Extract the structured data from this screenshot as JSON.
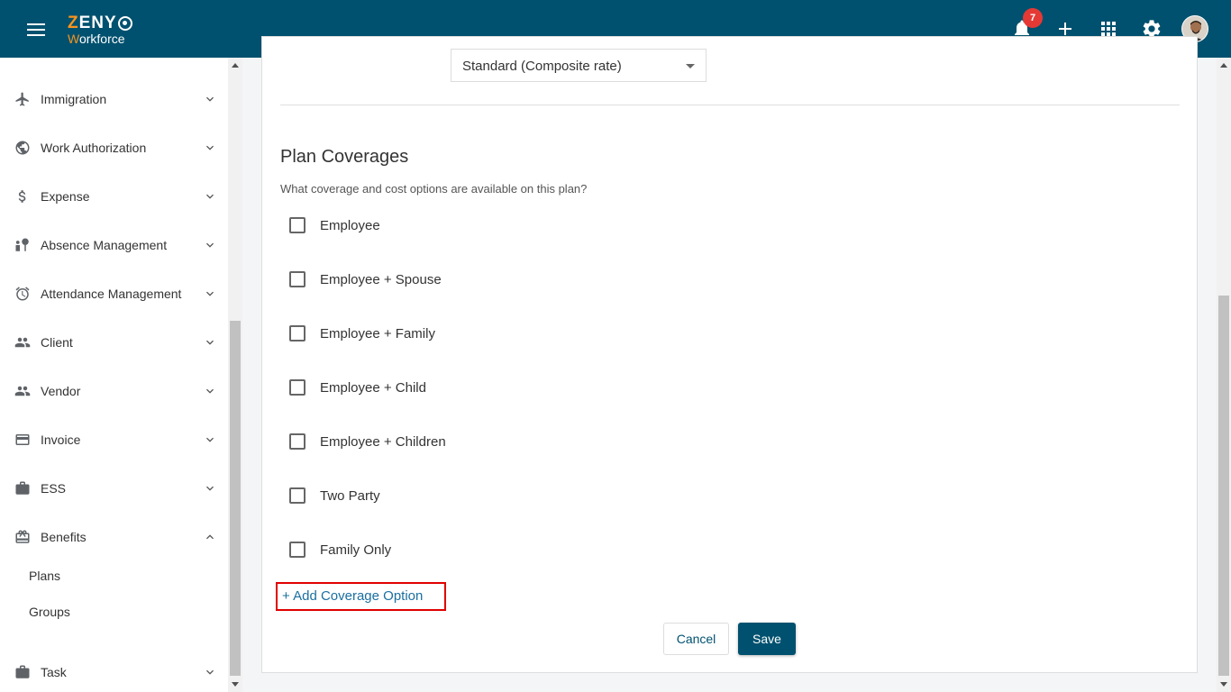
{
  "header": {
    "logo_main": "ZENY",
    "logo_sub": "Workforce",
    "notification_count": "7",
    "icons": [
      "menu-icon",
      "bell-icon",
      "plus-icon",
      "apps-grid-icon",
      "gear-icon",
      "avatar"
    ]
  },
  "sidebar": {
    "items": [
      {
        "label": "Immigration",
        "icon": "airplane-icon",
        "expanded": false
      },
      {
        "label": "Work Authorization",
        "icon": "globe-icon",
        "expanded": false
      },
      {
        "label": "Expense",
        "icon": "dollar-icon",
        "expanded": false
      },
      {
        "label": "Absence Management",
        "icon": "absence-icon",
        "expanded": false
      },
      {
        "label": "Attendance Management",
        "icon": "alarm-icon",
        "expanded": false
      },
      {
        "label": "Client",
        "icon": "people-icon",
        "expanded": false
      },
      {
        "label": "Vendor",
        "icon": "people-icon",
        "expanded": false
      },
      {
        "label": "Invoice",
        "icon": "card-icon",
        "expanded": false
      },
      {
        "label": "ESS",
        "icon": "briefcase-icon",
        "expanded": false
      },
      {
        "label": "Benefits",
        "icon": "gift-icon",
        "expanded": true
      },
      {
        "label": "Task",
        "icon": "briefcase-icon",
        "expanded": false
      }
    ],
    "benefits_sub": [
      "Plans",
      "Groups"
    ]
  },
  "form": {
    "rate_select_value": "Standard (Composite rate)",
    "section_title": "Plan Coverages",
    "section_desc": "What coverage and cost options are available on this plan?",
    "coverage_options": [
      {
        "label": "Employee",
        "checked": false
      },
      {
        "label": "Employee + Spouse",
        "checked": false
      },
      {
        "label": "Employee + Family",
        "checked": false
      },
      {
        "label": "Employee + Child",
        "checked": false
      },
      {
        "label": "Employee + Children",
        "checked": false
      },
      {
        "label": "Two Party",
        "checked": false
      },
      {
        "label": "Family Only",
        "checked": false
      }
    ],
    "add_option_label": "+ Add Coverage Option",
    "cancel_label": "Cancel",
    "save_label": "Save"
  },
  "colors": {
    "header_bg": "#00516f",
    "accent_orange": "#f7941d",
    "badge_red": "#e53935",
    "highlight_red": "#e00000",
    "link_blue": "#1a6fa0"
  }
}
